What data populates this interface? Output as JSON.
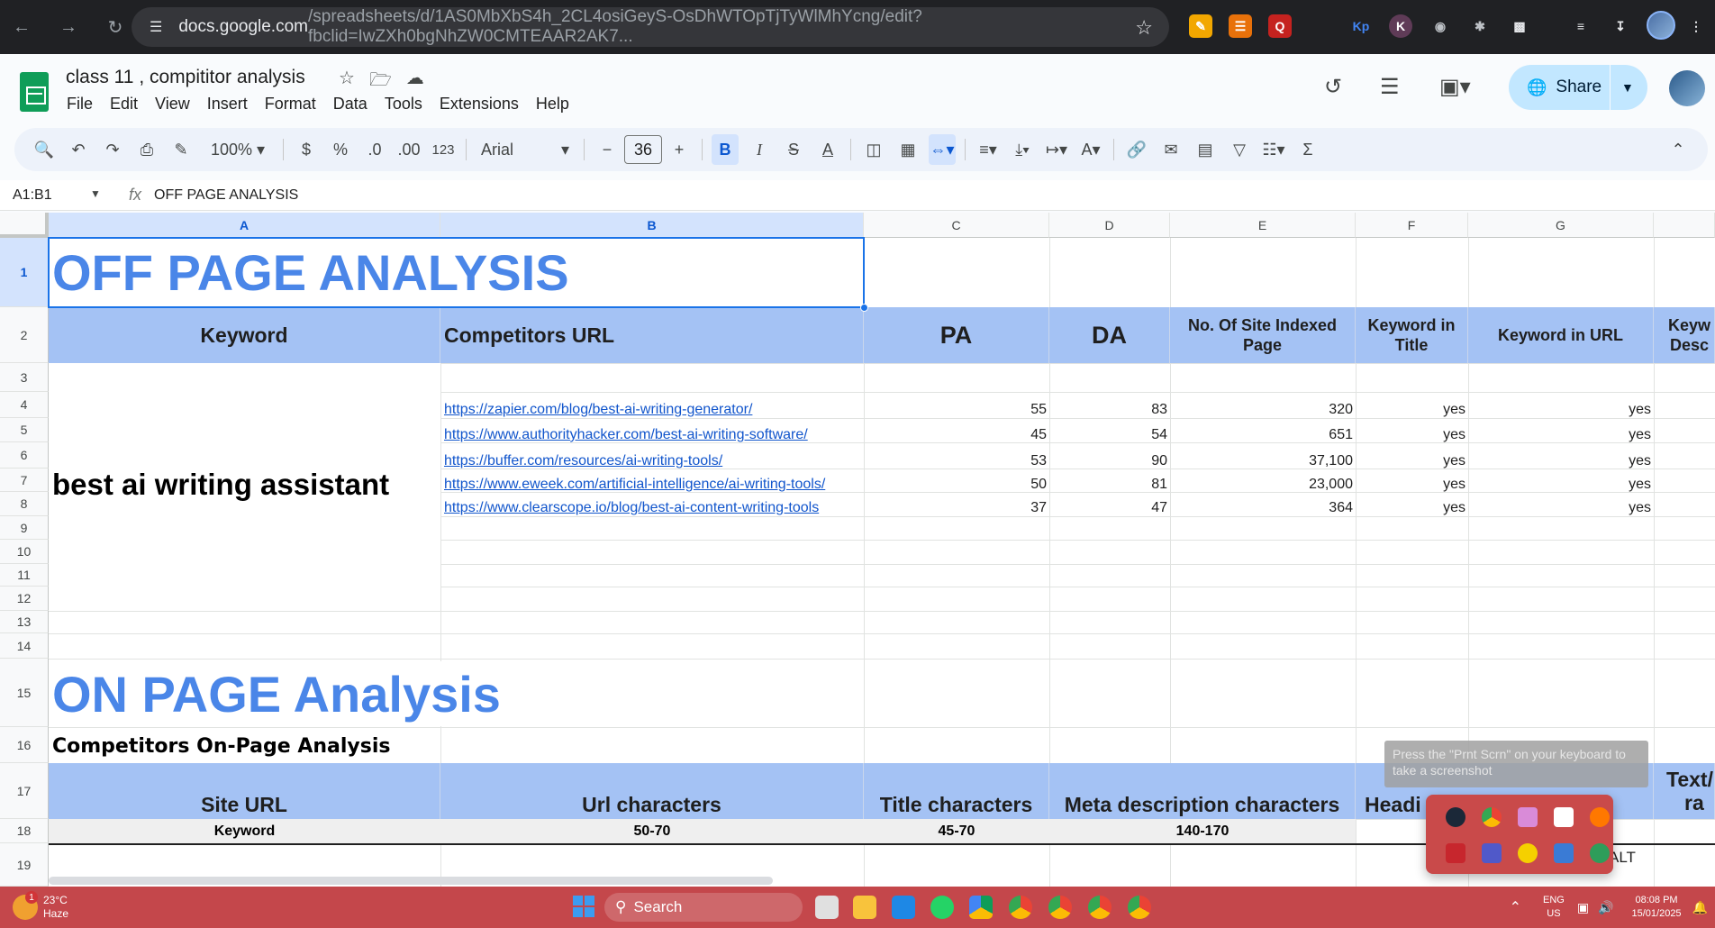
{
  "browser": {
    "url_host": "docs.google.com",
    "url_path": "/spreadsheets/d/1AS0MbXbS4h_2CL4osiGeyS-OsDhWTOpTjTyWlMhYcng/edit?fbclid=IwZXh0bgNhZW0CMTEAAR2AK7..."
  },
  "doc": {
    "title": "class 11 , compititor analysis",
    "menu": [
      "File",
      "Edit",
      "View",
      "Insert",
      "Format",
      "Data",
      "Tools",
      "Extensions",
      "Help"
    ],
    "share_label": "Share"
  },
  "toolbar": {
    "zoom": "100%",
    "currency": "$",
    "percent": "%",
    "dec_decrease": ".0",
    "dec_increase": ".00",
    "format_123": "123",
    "font": "Arial",
    "font_size": "36",
    "bold": "B",
    "italic": "I",
    "strike": "S",
    "text_color": "A"
  },
  "formula_bar": {
    "name_box": "A1:B1",
    "fx": "fx",
    "content": "OFF PAGE ANALYSIS"
  },
  "columns": [
    "A",
    "B",
    "C",
    "D",
    "E",
    "F",
    "G"
  ],
  "rows": [
    "1",
    "2",
    "3",
    "4",
    "5",
    "6",
    "7",
    "8",
    "9",
    "10",
    "11",
    "12",
    "13",
    "14",
    "15",
    "16",
    "17",
    "18",
    "19"
  ],
  "sheet": {
    "off_page_title": "OFF PAGE ANALYSIS",
    "headers": [
      "Keyword",
      "Competitors URL",
      "PA",
      "DA",
      "No. Of Site Indexed Page",
      "Keyword in Title",
      "Keyword in URL",
      "Keyw Desc"
    ],
    "keyword": "best ai writing assistant",
    "competitors": [
      {
        "url": "https://zapier.com/blog/best-ai-writing-generator/",
        "pa": "55",
        "da": "83",
        "indexed": "320",
        "kw_title": "yes",
        "kw_url": "yes"
      },
      {
        "url": "https://www.authorityhacker.com/best-ai-writing-software/",
        "pa": "45",
        "da": "54",
        "indexed": "651",
        "kw_title": "yes",
        "kw_url": "yes"
      },
      {
        "url": "https://buffer.com/resources/ai-writing-tools/",
        "pa": "53",
        "da": "90",
        "indexed": "37,100",
        "kw_title": "yes",
        "kw_url": "yes"
      },
      {
        "url": "https://www.eweek.com/artificial-intelligence/ai-writing-tools/",
        "pa": "50",
        "da": "81",
        "indexed": "23,000",
        "kw_title": "yes",
        "kw_url": "yes"
      },
      {
        "url": "https://www.clearscope.io/blog/best-ai-content-writing-tools",
        "pa": "37",
        "da": "47",
        "indexed": "364",
        "kw_title": "yes",
        "kw_url": "yes"
      }
    ],
    "on_page_title": "ON PAGE Analysis",
    "on_page_subtitle": "Competitors On-Page Analysis",
    "on_page_headers": [
      "Site URL",
      "Url characters",
      "Title characters",
      "Meta description characters",
      "Headi",
      "Text/",
      "ra"
    ],
    "row18": [
      "Keyword",
      "50-70",
      "45-70",
      "140-170"
    ],
    "row19_partial": "ALT"
  },
  "overlay": {
    "tooltip": "Press the \"Prnt Scrn\" on your keyboard to take a screenshot"
  },
  "taskbar": {
    "temp": "23°C",
    "weather": "Haze",
    "weather_badge": "1",
    "search": "Search",
    "lang1": "ENG",
    "lang2": "US",
    "time": "08:08 PM",
    "date": "15/01/2025"
  },
  "colors": {
    "header_blue": "#a4c2f4",
    "title_blue": "#4a86e8",
    "link": "#1155cc",
    "taskbar": "#c4474b"
  }
}
